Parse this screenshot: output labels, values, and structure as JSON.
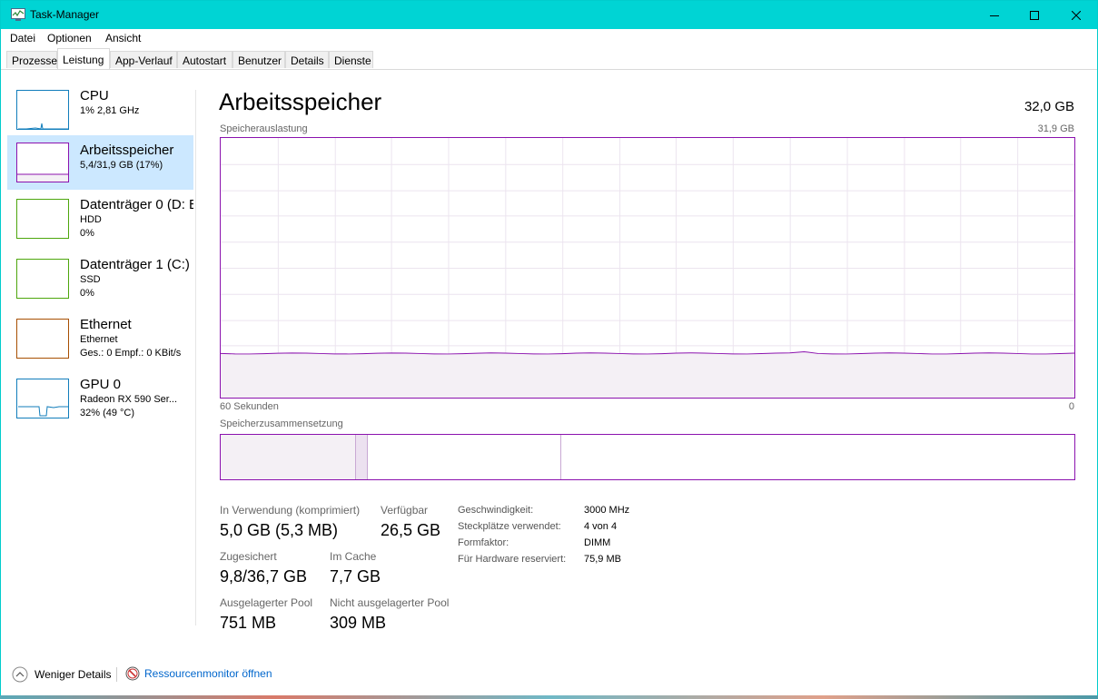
{
  "window": {
    "title": "Task-Manager"
  },
  "menu": [
    "Datei",
    "Optionen",
    "Ansicht"
  ],
  "tabs": [
    "Prozesse",
    "Leistung",
    "App-Verlauf",
    "Autostart",
    "Benutzer",
    "Details",
    "Dienste"
  ],
  "active_tab": "Leistung",
  "sidebar": {
    "items": [
      {
        "name": "CPU",
        "line1": "1% 2,81 GHz",
        "line2": "",
        "color": "#117dbb"
      },
      {
        "name": "Arbeitsspeicher",
        "line1": "5,4/31,9 GB (17%)",
        "line2": "",
        "color": "#8b12ae"
      },
      {
        "name": "Datenträger 0 (D: E",
        "line1": "HDD",
        "line2": "0%",
        "color": "#4da60c"
      },
      {
        "name": "Datenträger 1 (C:)",
        "line1": "SSD",
        "line2": "0%",
        "color": "#4da60c"
      },
      {
        "name": "Ethernet",
        "line1": "Ethernet",
        "line2": "Ges.: 0 Empf.: 0 KBit/s",
        "color": "#a74f01"
      },
      {
        "name": "GPU 0",
        "line1": "Radeon RX 590 Ser...",
        "line2": "32% (49 °C)",
        "color": "#117dbb"
      }
    ]
  },
  "main": {
    "title": "Arbeitsspeicher",
    "total": "32,0 GB",
    "usage_label": "Speicherauslastung",
    "usage_max": "31,9 GB",
    "time_left": "60 Sekunden",
    "time_right": "0",
    "composition_label": "Speicherzusammensetzung",
    "usage_fraction": 0.17,
    "stats": {
      "in_use_label": "In Verwendung (komprimiert)",
      "in_use": "5,0 GB (5,3 MB)",
      "available_label": "Verfügbar",
      "available": "26,5 GB",
      "committed_label": "Zugesichert",
      "committed": "9,8/36,7 GB",
      "cached_label": "Im Cache",
      "cached": "7,7 GB",
      "paged_label": "Ausgelagerter Pool",
      "paged": "751 MB",
      "nonpaged_label": "Nicht ausgelagerter Pool",
      "nonpaged": "309 MB"
    },
    "details": [
      {
        "label": "Geschwindigkeit:",
        "value": "3000 MHz"
      },
      {
        "label": "Steckplätze verwendet:",
        "value": "4 von 4"
      },
      {
        "label": "Formfaktor:",
        "value": "DIMM"
      },
      {
        "label": "Für Hardware reserviert:",
        "value": "75,9 MB"
      }
    ]
  },
  "footer": {
    "fewer_details": "Weniger Details",
    "resource_monitor": "Ressourcenmonitor öffnen"
  },
  "colors": {
    "titlebar": "#00d4d4",
    "memory": "#8b12ae",
    "selected": "#cce8ff",
    "link": "#0066cc"
  }
}
